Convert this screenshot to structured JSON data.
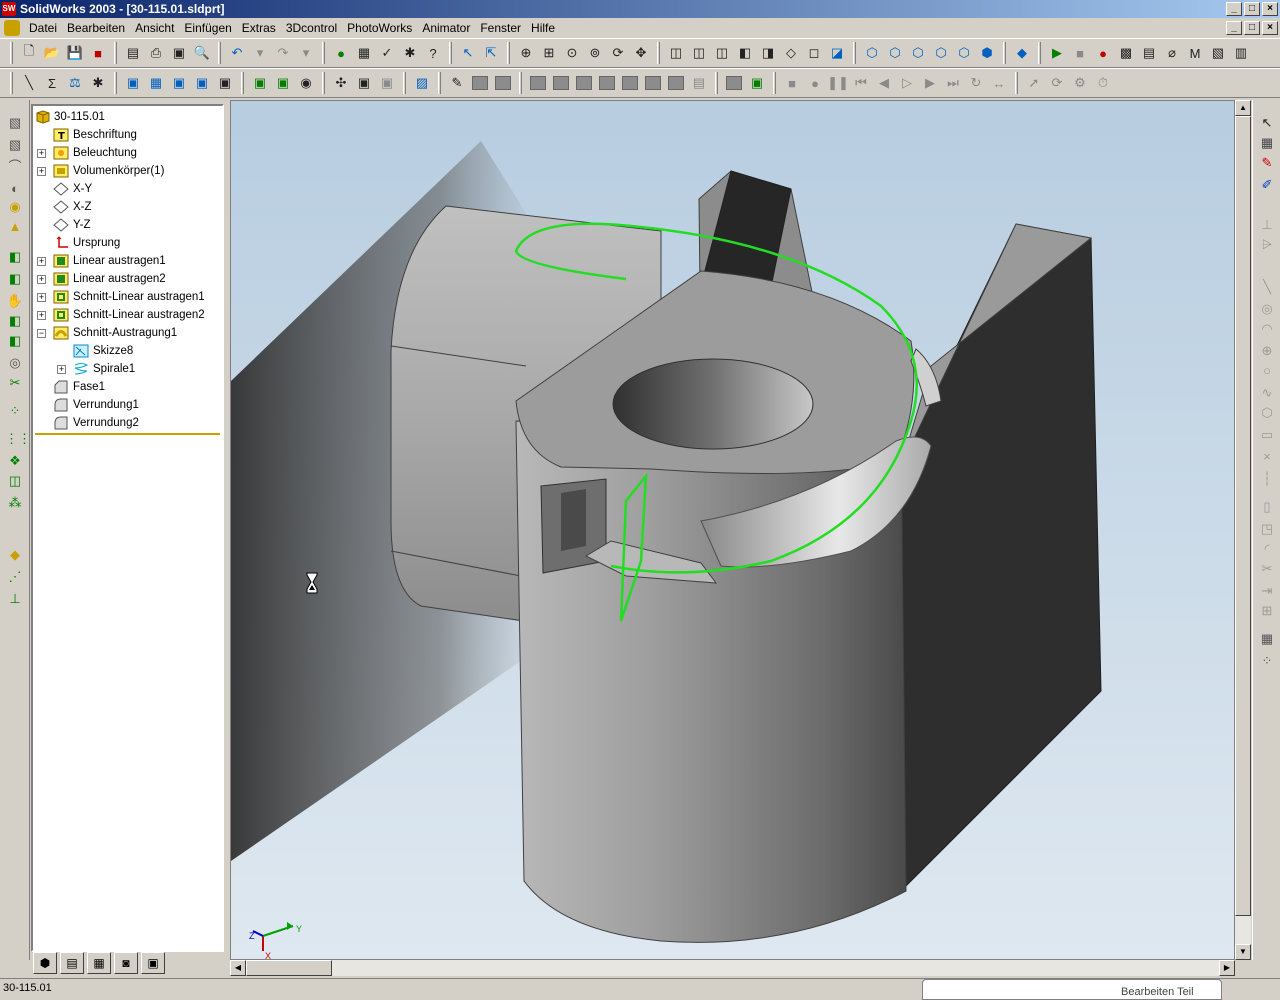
{
  "window": {
    "title": "SolidWorks 2003 - [30-115.01.sldprt]",
    "app_icon_text": "SW",
    "controls": [
      "_",
      "□",
      "×"
    ]
  },
  "menu": [
    "Datei",
    "Bearbeiten",
    "Ansicht",
    "Einfügen",
    "Extras",
    "3Dcontrol",
    "PhotoWorks",
    "Animator",
    "Fenster",
    "Hilfe"
  ],
  "tree": {
    "root": "30-115.01",
    "items": [
      {
        "label": "Beschriftung",
        "icon": "annotation-icon",
        "expandable": false
      },
      {
        "label": "Beleuchtung",
        "icon": "lighting-icon",
        "expandable": true
      },
      {
        "label": "Volumenkörper(1)",
        "icon": "solid-bodies-icon",
        "expandable": true
      },
      {
        "label": "X-Y",
        "icon": "plane-icon",
        "expandable": false
      },
      {
        "label": "X-Z",
        "icon": "plane-icon",
        "expandable": false
      },
      {
        "label": "Y-Z",
        "icon": "plane-icon",
        "expandable": false
      },
      {
        "label": "Ursprung",
        "icon": "origin-icon",
        "expandable": false
      },
      {
        "label": "Linear austragen1",
        "icon": "extrude-icon",
        "expandable": true
      },
      {
        "label": "Linear austragen2",
        "icon": "extrude-icon",
        "expandable": true
      },
      {
        "label": "Schnitt-Linear austragen1",
        "icon": "cut-extrude-icon",
        "expandable": true
      },
      {
        "label": "Schnitt-Linear austragen2",
        "icon": "cut-extrude-icon",
        "expandable": true
      },
      {
        "label": "Schnitt-Austragung1",
        "icon": "cut-sweep-icon",
        "expandable": true,
        "expanded": true
      },
      {
        "label": "Skizze8",
        "icon": "sketch-icon",
        "expandable": false,
        "child": true
      },
      {
        "label": "Spirale1",
        "icon": "helix-icon",
        "expandable": true,
        "child": true
      },
      {
        "label": "Fase1",
        "icon": "chamfer-icon",
        "expandable": false
      },
      {
        "label": "Verrundung1",
        "icon": "fillet-icon",
        "expandable": false
      },
      {
        "label": "Verrundung2",
        "icon": "fillet-icon",
        "expandable": false
      }
    ]
  },
  "triad": {
    "x": "X",
    "y": "Y",
    "z": "Z"
  },
  "status": {
    "left": "30-115.01",
    "popup": "Bearbeiten Teil"
  },
  "colors": {
    "titlebar": "#0a246a",
    "helix": "#22dd22",
    "face_light": "#9a9a9a",
    "face_dark": "#303030",
    "viewport_bg": "#c8d8e8"
  }
}
